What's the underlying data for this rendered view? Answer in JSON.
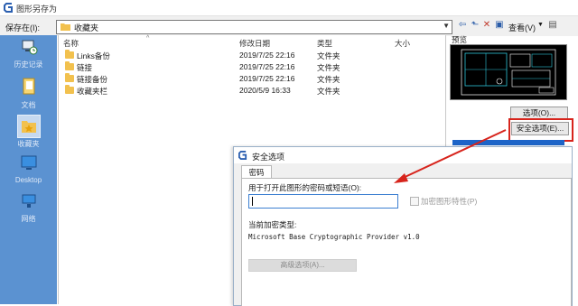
{
  "window": {
    "title": "图形另存为"
  },
  "toolbar": {
    "save_in_label": "保存在(I):",
    "current_folder": "收藏夹",
    "view_label": "查看(V)"
  },
  "places": [
    {
      "label": "历史记录",
      "icon": "history-icon"
    },
    {
      "label": "文档",
      "icon": "documents-icon"
    },
    {
      "label": "收藏夹",
      "icon": "favorites-icon",
      "selected": true
    },
    {
      "label": "Desktop",
      "icon": "desktop-icon"
    },
    {
      "label": "网络",
      "icon": "network-icon"
    }
  ],
  "file_list": {
    "columns": [
      "名称",
      "修改日期",
      "类型",
      "大小"
    ],
    "rows": [
      {
        "name": "Links备份",
        "modified": "2019/7/25 22:16",
        "type": "文件夹",
        "size": ""
      },
      {
        "name": "链接",
        "modified": "2019/7/25 22:16",
        "type": "文件夹",
        "size": ""
      },
      {
        "name": "链接备份",
        "modified": "2019/7/25 22:16",
        "type": "文件夹",
        "size": ""
      },
      {
        "name": "收藏夹栏",
        "modified": "2020/5/9 16:33",
        "type": "文件夹",
        "size": ""
      }
    ]
  },
  "preview": {
    "label": "预览"
  },
  "buttons": {
    "options": "选项(O)...",
    "security_options": "安全选项(E)..."
  },
  "dialog": {
    "title": "安全选项",
    "tab_password": "密码",
    "password_prompt": "用于打开此图形的密码或短语(O):",
    "password_value": "",
    "encrypt_properties_label": "加密图形特性(P)",
    "encrypt_properties_checked": false,
    "encryption_type_label": "当前加密类型:",
    "encryption_type_value": "Microsoft Base Cryptographic Provider v1.0",
    "advanced_button": "高级选项(A)..."
  },
  "colors": {
    "sidebar": "#5b92d1",
    "highlight_box": "#d7241c",
    "annotation_arrow": "#d7241c",
    "input_focus": "#3c7fd1"
  }
}
